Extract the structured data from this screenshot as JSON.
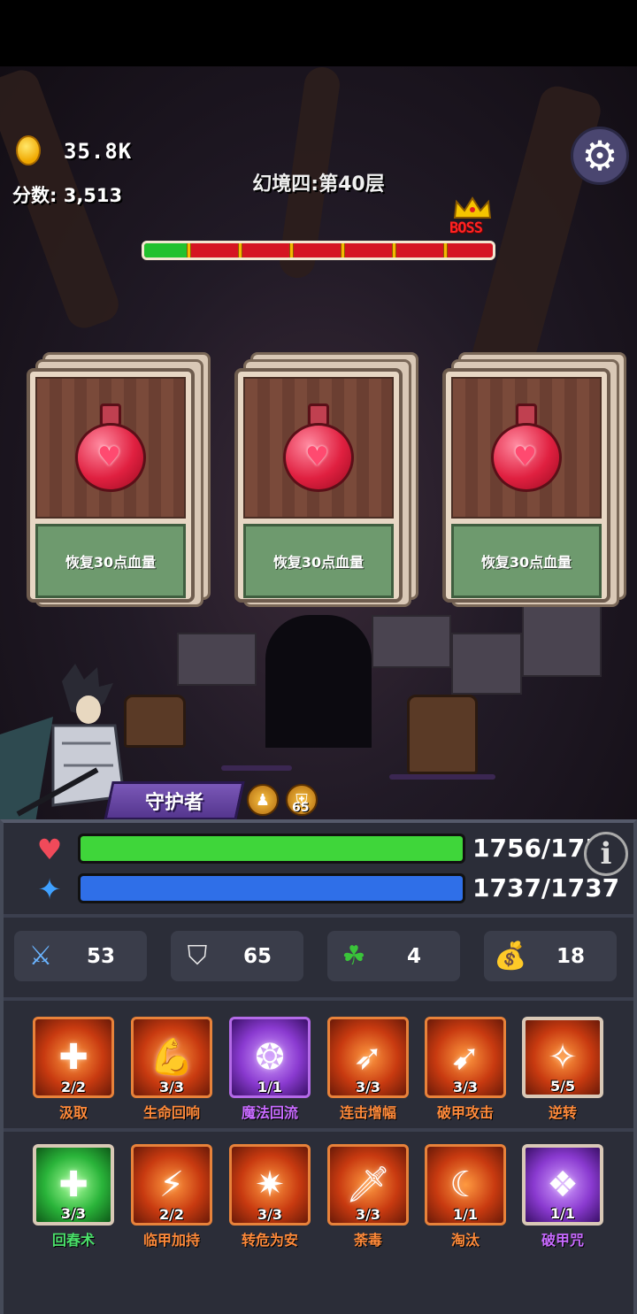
{
  "currency": {
    "coins": "35.8K",
    "icon": "coin-icon"
  },
  "score": {
    "label": "分数:",
    "value": "3,513"
  },
  "level": {
    "title": "幻境四:第40层",
    "boss_label": "BOSS",
    "progress": 0.13,
    "checkpoints": 7
  },
  "cards": [
    {
      "item": "red-heart-potion",
      "description": "恢复30点血量"
    },
    {
      "item": "red-heart-potion",
      "description": "恢复30点血量"
    },
    {
      "item": "red-heart-potion",
      "description": "恢复30点血量"
    }
  ],
  "hero": {
    "class_name": "守护者",
    "badge_level": "65"
  },
  "vitals": {
    "hp": {
      "text": "1756/175",
      "current": 1756,
      "icon": "heart-icon",
      "color": "#3fd63a"
    },
    "mp": {
      "text": "1737/1737",
      "current": 1737,
      "max": 1737,
      "icon": "mana-icon",
      "color": "#2f6fe8"
    }
  },
  "stats": [
    {
      "icon": "sword-icon",
      "value": "53"
    },
    {
      "icon": "shield-icon",
      "value": "65"
    },
    {
      "icon": "clover-icon",
      "value": "4"
    },
    {
      "icon": "money-bag-icon",
      "value": "18"
    }
  ],
  "skills_row1": [
    {
      "name": "汲取",
      "count": "2/2",
      "rarity": "orange"
    },
    {
      "name": "生命回响",
      "count": "3/3",
      "rarity": "orange"
    },
    {
      "name": "魔法回流",
      "count": "1/1",
      "rarity": "purple"
    },
    {
      "name": "连击增幅",
      "count": "3/3",
      "rarity": "orange"
    },
    {
      "name": "破甲攻击",
      "count": "3/3",
      "rarity": "orange"
    },
    {
      "name": "逆转",
      "count": "5/5",
      "rarity": "orange"
    }
  ],
  "skills_row2": [
    {
      "name": "回春术",
      "count": "3/3",
      "rarity": "green"
    },
    {
      "name": "临甲加持",
      "count": "2/2",
      "rarity": "orange"
    },
    {
      "name": "转危为安",
      "count": "3/3",
      "rarity": "orange"
    },
    {
      "name": "荼毒",
      "count": "3/3",
      "rarity": "orange"
    },
    {
      "name": "淘汰",
      "count": "1/1",
      "rarity": "orange"
    },
    {
      "name": "破甲咒",
      "count": "1/1",
      "rarity": "purple"
    }
  ]
}
